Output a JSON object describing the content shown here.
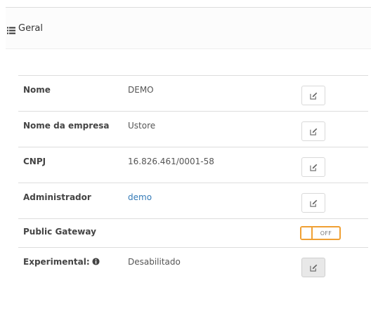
{
  "panel": {
    "title": "Geral",
    "icon": "list-icon"
  },
  "rows": [
    {
      "label": "Nome",
      "value": "DEMO",
      "action": "edit-icon"
    },
    {
      "label": "Nome da empresa",
      "value": "Ustore",
      "action": "edit-icon"
    },
    {
      "label": "CNPJ",
      "value": "16.826.461/0001-58",
      "action": "edit-icon"
    },
    {
      "label": "Administrador",
      "value": "demo",
      "action": "edit-icon",
      "value_color": "#337ab7"
    },
    {
      "label": "Public Gateway",
      "toggle_state": "OFF",
      "toggle_color": "#f0a033"
    },
    {
      "label": "Experimental:",
      "value": "Desabilitado",
      "action": "edit-icon",
      "action_disabled": true
    }
  ]
}
